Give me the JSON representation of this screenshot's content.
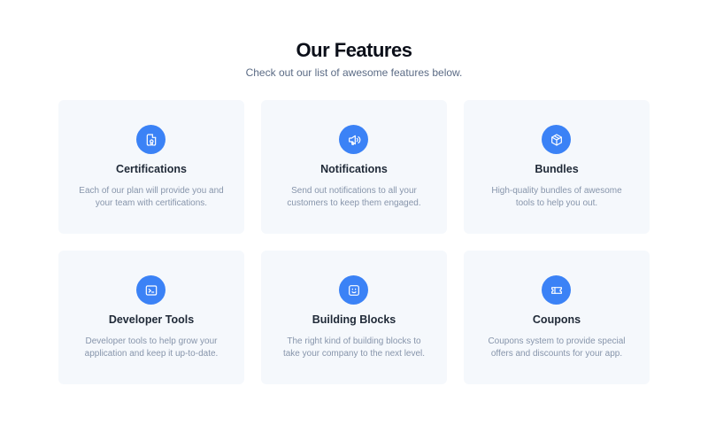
{
  "header": {
    "title": "Our Features",
    "subtitle": "Check out our list of awesome features below."
  },
  "colors": {
    "accent": "#3b82f6",
    "card_bg": "#f5f8fc",
    "title_text": "#0b0f19",
    "muted_text": "#8795ab"
  },
  "features": [
    {
      "icon": "certificate-icon",
      "title": "Certifications",
      "description": "Each of our plan will provide you and your team with certifications."
    },
    {
      "icon": "megaphone-icon",
      "title": "Notifications",
      "description": "Send out notifications to all your customers to keep them engaged."
    },
    {
      "icon": "cube-icon",
      "title": "Bundles",
      "description": "High-quality bundles of awesome tools to help you out."
    },
    {
      "icon": "terminal-icon",
      "title": "Developer Tools",
      "description": "Developer tools to help grow your application and keep it up-to-date."
    },
    {
      "icon": "face-icon",
      "title": "Building Blocks",
      "description": "The right kind of building blocks to take your company to the next level."
    },
    {
      "icon": "ticket-icon",
      "title": "Coupons",
      "description": "Coupons system to provide special offers and discounts for your app."
    }
  ]
}
